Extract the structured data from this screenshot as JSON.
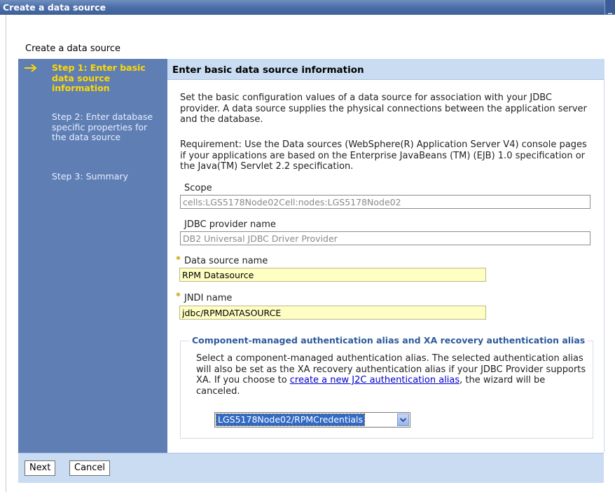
{
  "window": {
    "title": "Create a data source"
  },
  "wizard": {
    "title": "Create a data source"
  },
  "steps": [
    "Step 1: Enter basic data source information",
    "Step 2: Enter database specific properties for the data source",
    "Step 3: Summary"
  ],
  "content": {
    "header": "Enter basic data source information",
    "intro": "Set the basic configuration values of a data source for association with your JDBC provider. A data source supplies the physical connections between the application server and the database.",
    "requirement": "Requirement: Use the Data sources (WebSphere(R) Application Server V4) console pages if your applications are based on the Enterprise JavaBeans (TM) (EJB) 1.0 specification or the Java(TM) Servlet 2.2 specification."
  },
  "fields": {
    "scope": {
      "label": "Scope",
      "value": "cells:LGS5178Node02Cell:nodes:LGS5178Node02"
    },
    "provider": {
      "label": "JDBC provider name",
      "value": "DB2 Universal JDBC Driver Provider"
    },
    "ds_name": {
      "label": "Data source name",
      "value": "RPM Datasource"
    },
    "jndi": {
      "label": "JNDI name",
      "value": "jdbc/RPMDATASOURCE"
    },
    "required_mark": "*"
  },
  "auth": {
    "legend": "Component-managed authentication alias and XA recovery authentication alias",
    "text_before": "Select a component-managed authentication alias. The selected authentication alias will also be set as the XA recovery authentication alias if your JDBC Provider supports XA. If you choose to ",
    "link": "create a new J2C authentication alias",
    "text_after": ", the wizard will be canceled.",
    "selected": "LGS5178Node02/RPMCredentials"
  },
  "buttons": {
    "next": "Next",
    "cancel": "Cancel"
  },
  "colors": {
    "sidebar": "#5f7fb4",
    "active_step": "#ffd800",
    "header_band": "#c9dcf2",
    "editable_field": "#ffffc4",
    "link": "#0000cc"
  }
}
